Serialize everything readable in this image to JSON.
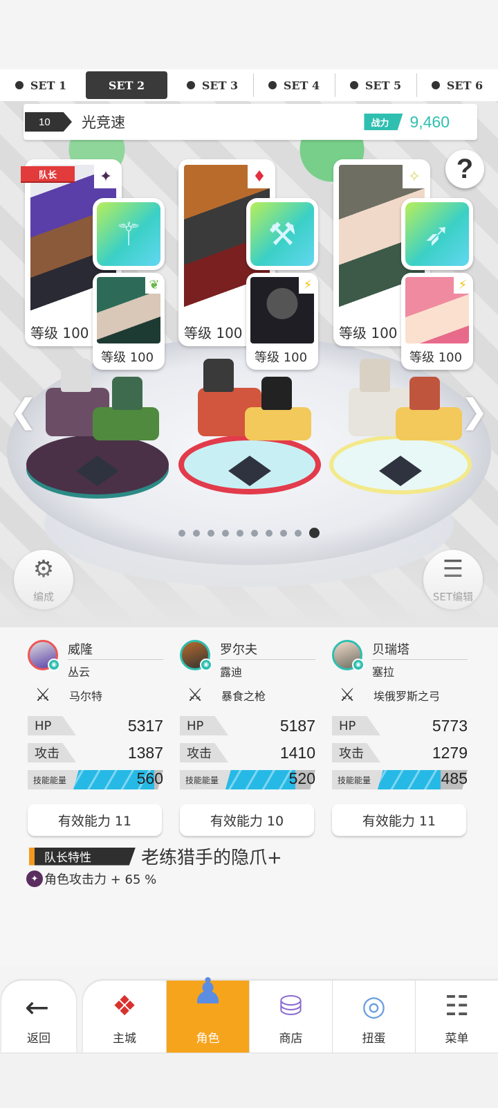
{
  "set_tabs": [
    "SET 1",
    "SET 2",
    "SET 3",
    "SET 4",
    "SET 5",
    "SET 6"
  ],
  "active_set": "SET 2",
  "team": {
    "number": "10",
    "name": "光竞速",
    "power_label": "战力",
    "power_value": "9,460"
  },
  "help_label": "?",
  "leader_tag": "队长",
  "slots": [
    {
      "hero_level": "等级 100",
      "element": "dark",
      "sub_level": "等级 100",
      "sub_element": "earth",
      "weapon_icon": "staff-icon"
    },
    {
      "hero_level": "等级 100",
      "element": "basic",
      "sub_level": "等级 100",
      "sub_element": "light",
      "weapon_icon": "spear-icon"
    },
    {
      "hero_level": "等级 100",
      "element": "light",
      "sub_level": "等级 100",
      "sub_element": "light",
      "weapon_icon": "bow-icon"
    }
  ],
  "page_dots": {
    "count": 10,
    "active": 10
  },
  "buttons": {
    "formation": "编成",
    "set_edit": "SET编辑"
  },
  "stat_labels": {
    "hp": "HP",
    "atk": "攻击",
    "skill": "技能能量"
  },
  "characters": [
    {
      "name": "威隆",
      "sub_name": "丛云",
      "weapon": "马尔特",
      "hp": "5317",
      "atk": "1387",
      "skill_energy": "560",
      "skill_fill": 0.9,
      "ability": "有效能力 11"
    },
    {
      "name": "罗尔夫",
      "sub_name": "露迪",
      "weapon": "暴食之枪",
      "hp": "5187",
      "atk": "1410",
      "skill_energy": "520",
      "skill_fill": 0.78,
      "ability": "有效能力 10"
    },
    {
      "name": "贝瑞塔",
      "sub_name": "塞拉",
      "weapon": "埃俄罗斯之弓",
      "hp": "5773",
      "atk": "1279",
      "skill_energy": "485",
      "skill_fill": 0.7,
      "ability": "有效能力 11"
    }
  ],
  "leader_skill": {
    "tag": "队长特性",
    "name": "老练猎手的隐爪+",
    "effect": "角色攻击力 + 65 %"
  },
  "nav": {
    "back": "返回",
    "items": [
      "主城",
      "角色",
      "商店",
      "扭蛋",
      "菜单"
    ],
    "active": "角色"
  },
  "colors": {
    "accent_teal": "#2fbfb0",
    "leader_red": "#e23b3b",
    "nav_active": "#f7a41d",
    "skill_blue": "#27b9e6"
  }
}
